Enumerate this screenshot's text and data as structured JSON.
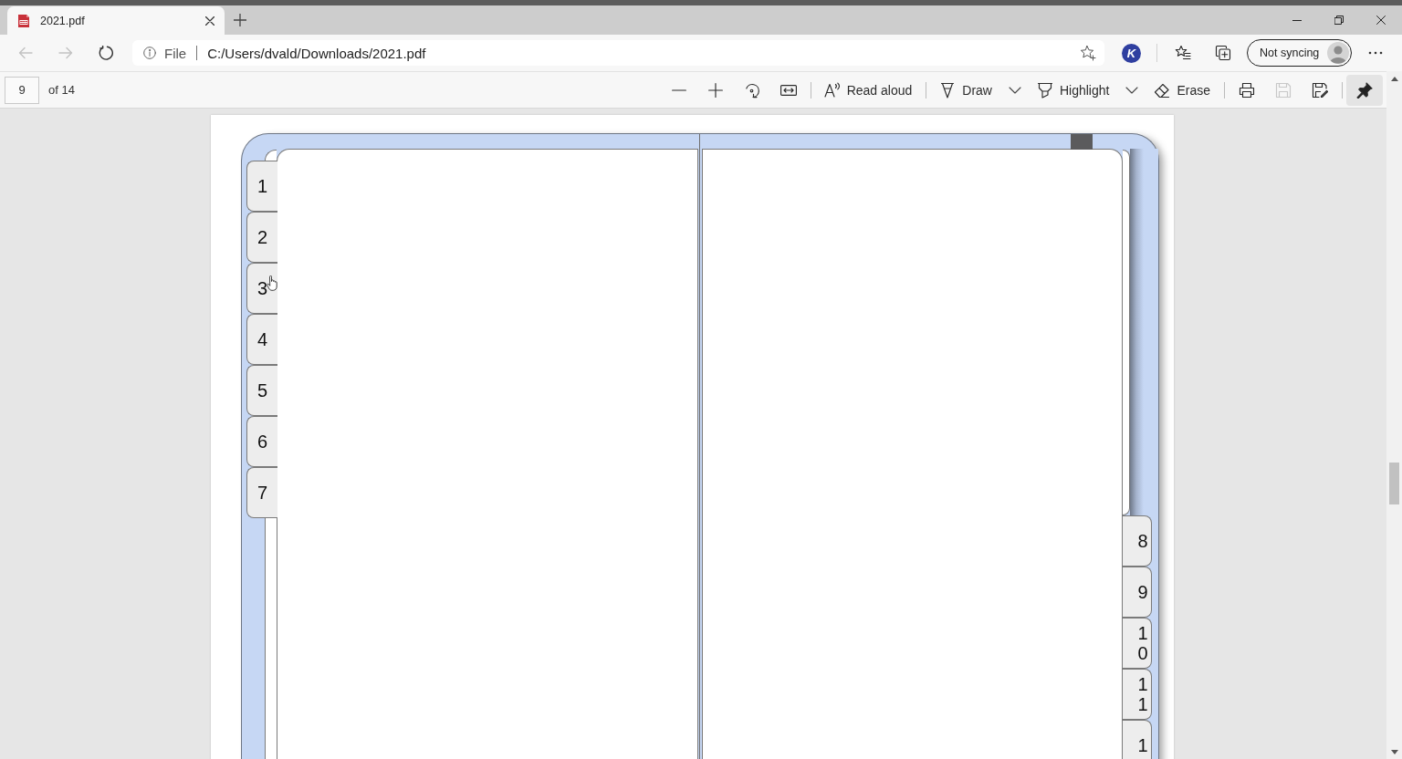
{
  "browser": {
    "tabs": [
      {
        "kind": "pdf",
        "title": "2021.pdf",
        "selected": true
      }
    ],
    "nav_buttons": [
      {
        "kind": "back",
        "disabled": true
      },
      {
        "kind": "forward",
        "disabled": true
      },
      {
        "kind": "refresh",
        "disabled": false
      }
    ],
    "address_bar": {
      "site_label": "File",
      "url": "C:/Users/dvald/Downloads/2021.pdf"
    },
    "extension": {
      "letter": "K"
    },
    "profile": {
      "label": "Not syncing"
    }
  },
  "pdf_toolbar": {
    "page_field": {
      "value": "9"
    },
    "page_count": "of 14",
    "tool_groups": [
      [
        {
          "kind": "zoom-out",
          "disabled": false,
          "pressed": false,
          "dropdown": false
        },
        {
          "kind": "zoom-in",
          "disabled": false,
          "pressed": false,
          "dropdown": false
        },
        {
          "kind": "rotate",
          "disabled": false,
          "pressed": false,
          "dropdown": false
        },
        {
          "kind": "fit-width",
          "disabled": false,
          "pressed": false,
          "dropdown": false
        }
      ],
      [
        {
          "kind": "read-aloud",
          "label": "Read aloud",
          "disabled": false,
          "pressed": false,
          "dropdown": false
        }
      ],
      [
        {
          "kind": "draw",
          "label": "Draw",
          "disabled": false,
          "pressed": false,
          "dropdown": true
        },
        {
          "kind": "highlight",
          "label": "Highlight",
          "disabled": false,
          "pressed": false,
          "dropdown": true
        },
        {
          "kind": "erase",
          "label": "Erase",
          "disabled": false,
          "pressed": false,
          "dropdown": false
        }
      ],
      [
        {
          "kind": "print",
          "disabled": false,
          "pressed": false,
          "dropdown": false
        },
        {
          "kind": "save",
          "disabled": true,
          "pressed": false,
          "dropdown": false
        },
        {
          "kind": "save-as",
          "disabled": false,
          "pressed": false,
          "dropdown": false
        }
      ],
      [
        {
          "kind": "pin",
          "disabled": false,
          "pressed": true,
          "dropdown": false
        }
      ]
    ]
  },
  "document": {
    "left_tabs": [
      {
        "label": "1"
      },
      {
        "label": "2"
      },
      {
        "label": "3"
      },
      {
        "label": "4"
      },
      {
        "label": "5"
      },
      {
        "label": "6"
      },
      {
        "label": "7"
      }
    ],
    "right_tabs": [
      {
        "label": "8"
      },
      {
        "label": "9"
      },
      {
        "label": "10"
      },
      {
        "label": "11"
      },
      {
        "label": "1"
      }
    ]
  }
}
